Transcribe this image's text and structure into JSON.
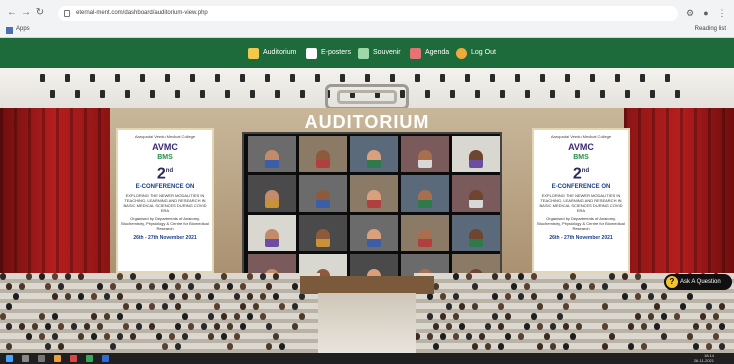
{
  "browser": {
    "url": "eternal-ment.com/dashboard/auditorium-view.php",
    "bookmarks_apps": "Apps",
    "reading_list": "Reading list"
  },
  "nav": {
    "items": [
      {
        "label": "Auditorium",
        "icon": "auditorium-icon"
      },
      {
        "label": "E-posters",
        "icon": "document-icon"
      },
      {
        "label": "Souvenir",
        "icon": "people-icon"
      },
      {
        "label": "Agenda",
        "icon": "agenda-icon"
      },
      {
        "label": "Log Out",
        "icon": "power-icon"
      }
    ]
  },
  "scene": {
    "title": "AUDITORIUM",
    "banner": {
      "org_line": "Aarupadai Veedu Medical College",
      "logo_text": "AVMC",
      "sub_logo": "BMS",
      "number": "2",
      "number_suffix": "nd",
      "heading": "E-CONFERENCE ON",
      "desc": "EXPLORING THE NEWER MODALITIES IN TEACHING, LEARNING AND RESEARCH IN BASIC MEDICAL SCIENCES DURING COVID ERA",
      "organised": "Organised by Departments of Anatomy, Biochemistry, Physiology & Centre for Biomedical Research",
      "date": "26th - 27th November 2021"
    },
    "participants": [
      "Participant 1",
      "Participant 2",
      "Participant 3",
      "Participant 4",
      "Participant 5",
      "Participant 6",
      "Participant 7",
      "Participant 8",
      "Participant 9",
      "Participant 10",
      "Participant 11",
      "Participant 12",
      "Participant 13",
      "Participant 14",
      "Participant 15",
      "Participant 16",
      "Participant 17",
      "Participant 18",
      "Participant 19",
      "Participant 20",
      "Participant 21",
      "Participant 22",
      "Participant 23",
      "Participant 24",
      "Participant 25"
    ],
    "ask_label": "Ask A Question"
  },
  "colors": {
    "nav_green": "#1d6b3a",
    "wall_red": "#b51e1e",
    "screen_bg": "#0c0c0c"
  },
  "taskbar": {
    "time": "18:14",
    "date": "26-11-2021"
  }
}
